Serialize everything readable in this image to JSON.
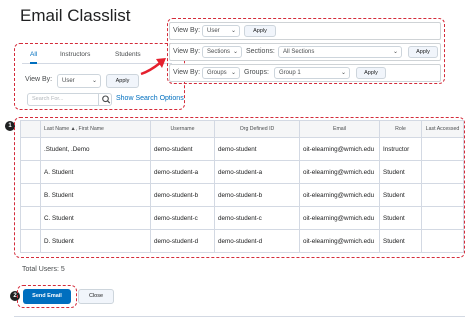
{
  "page": {
    "title": "Email Classlist"
  },
  "tabs": [
    {
      "label": "All"
    },
    {
      "label": "Instructors"
    },
    {
      "label": "Students"
    }
  ],
  "filter": {
    "view_by_label": "View By:",
    "view_by_value": "User",
    "apply_label": "Apply",
    "search_placeholder": "Search For...",
    "show_search_options": "Show Search Options"
  },
  "filter_variants": [
    {
      "view_by_label": "View By:",
      "view_by_value": "User",
      "apply_label": "Apply"
    },
    {
      "view_by_label": "View By:",
      "view_by_value": "Sections",
      "second_label": "Sections:",
      "second_value": "All Sections",
      "apply_label": "Apply"
    },
    {
      "view_by_label": "View By:",
      "view_by_value": "Groups",
      "second_label": "Groups:",
      "second_value": "Group 1",
      "apply_label": "Apply"
    }
  ],
  "table": {
    "headers": [
      "Last Name ▲, First Name",
      "Username",
      "Org Defined ID",
      "Email",
      "Role",
      "Last Accessed"
    ],
    "rows": [
      [
        ".Student, .Demo",
        "demo-student",
        "demo-student",
        "oit-elearning@wmich.edu",
        "Instructor",
        ""
      ],
      [
        "A. Student",
        "demo-student-a",
        "demo-student-a",
        "oit-elearning@wmich.edu",
        "Student",
        ""
      ],
      [
        "B. Student",
        "demo-student-b",
        "demo-student-b",
        "oit-elearning@wmich.edu",
        "Student",
        ""
      ],
      [
        "C. Student",
        "demo-student-c",
        "demo-student-c",
        "oit-elearning@wmich.edu",
        "Student",
        ""
      ],
      [
        "D. Student",
        "demo-student-d",
        "demo-student-d",
        "oit-elearning@wmich.edu",
        "Student",
        ""
      ]
    ]
  },
  "badges": {
    "one": "1",
    "two": "2"
  },
  "footer": {
    "total_users": "Total Users: 5",
    "send_label": "Send Email",
    "close_label": "Close"
  },
  "colors": {
    "accent": "#006fbf",
    "annotation": "#d42b3a"
  }
}
